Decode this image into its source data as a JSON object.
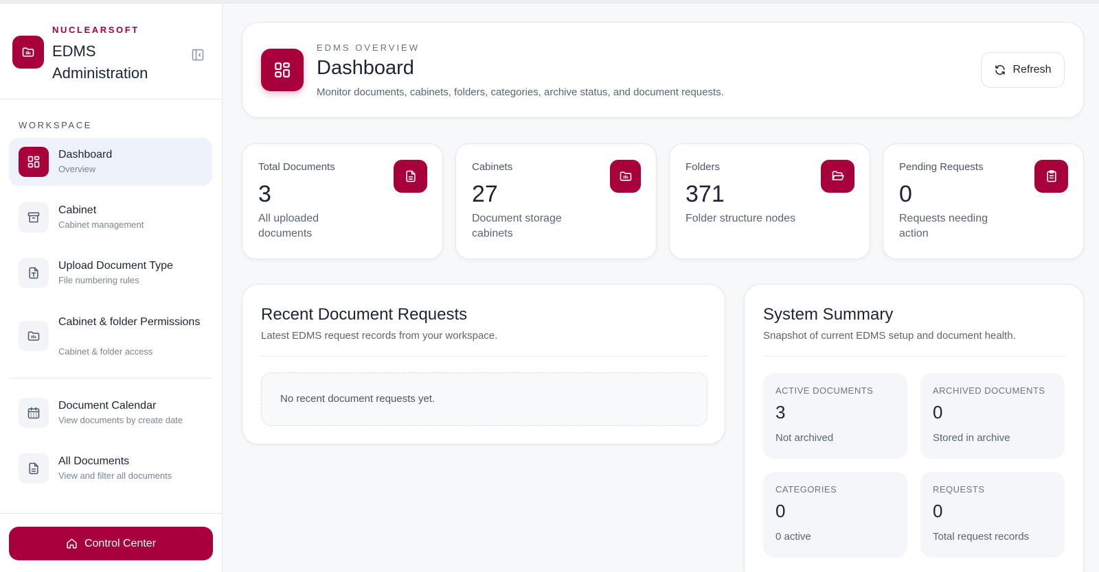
{
  "brand": {
    "company": "NUCLEARSOFT",
    "title": "EDMS Administration"
  },
  "sidebar": {
    "section_label": "WORKSPACE",
    "items": [
      {
        "label": "Dashboard",
        "sub": "Overview",
        "icon": "grid-icon",
        "active": true
      },
      {
        "label": "Cabinet",
        "sub": "Cabinet management",
        "icon": "archive-box-icon"
      },
      {
        "label": "Upload Document Type",
        "sub": "File numbering rules",
        "icon": "file-type-icon"
      },
      {
        "label": "Cabinet & folder Permissions",
        "sub": "Cabinet & folder access",
        "icon": "folder-chart-icon"
      },
      {
        "label": "Document Calendar",
        "sub": "View documents by create date",
        "icon": "calendar-icon"
      },
      {
        "label": "All Documents",
        "sub": "View and filter all documents",
        "icon": "document-icon"
      }
    ],
    "control_center_label": "Control Center"
  },
  "header": {
    "eyebrow": "EDMS OVERVIEW",
    "title": "Dashboard",
    "description": "Monitor documents, cabinets, folders, categories, archive status, and document requests.",
    "refresh_label": "Refresh"
  },
  "stats": [
    {
      "label": "Total Documents",
      "value": "3",
      "sub": "All uploaded documents",
      "icon": "document-icon"
    },
    {
      "label": "Cabinets",
      "value": "27",
      "sub": "Document storage cabinets",
      "icon": "folder-chart-icon"
    },
    {
      "label": "Folders",
      "value": "371",
      "sub": "Folder structure nodes",
      "icon": "folder-open-icon"
    },
    {
      "label": "Pending Requests",
      "value": "0",
      "sub": "Requests needing action",
      "icon": "clipboard-icon"
    }
  ],
  "recent": {
    "title": "Recent Document Requests",
    "description": "Latest EDMS request records from your workspace.",
    "empty": "No recent document requests yet."
  },
  "summary": {
    "title": "System Summary",
    "description": "Snapshot of current EDMS setup and document health.",
    "tiles": [
      {
        "label": "ACTIVE DOCUMENTS",
        "value": "3",
        "sub": "Not archived"
      },
      {
        "label": "ARCHIVED DOCUMENTS",
        "value": "0",
        "sub": "Stored in archive"
      },
      {
        "label": "CATEGORIES",
        "value": "0",
        "sub": "0 active"
      },
      {
        "label": "REQUESTS",
        "value": "0",
        "sub": "Total request records"
      }
    ]
  },
  "colors": {
    "accent": "#a8003a",
    "active_bg": "#eef2fb"
  }
}
